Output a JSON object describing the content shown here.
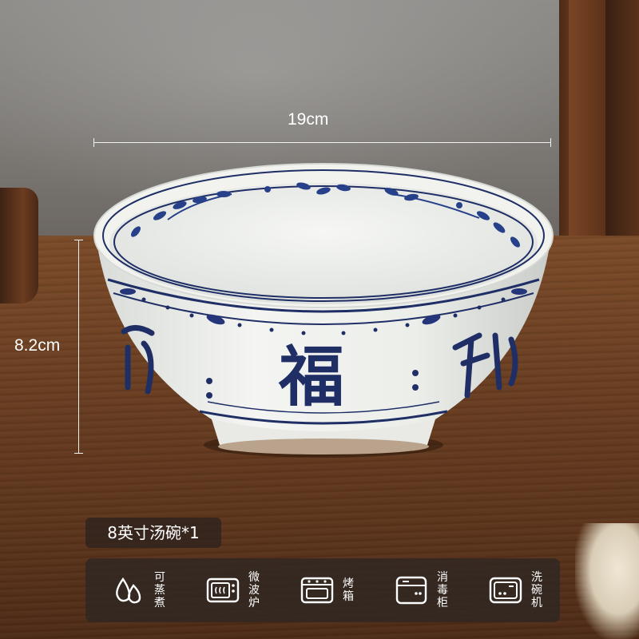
{
  "dimensions": {
    "width": "19cm",
    "height": "8.2cm"
  },
  "bowl": {
    "character": "福"
  },
  "product": {
    "label": "8英寸汤碗*1"
  },
  "features": [
    {
      "icon": "steam-drops-icon",
      "label": "可蒸煮"
    },
    {
      "icon": "microwave-icon",
      "label": "微波炉"
    },
    {
      "icon": "oven-icon",
      "label": "烤箱"
    },
    {
      "icon": "sterilizer-cabinet-icon",
      "label": "消毒柜"
    },
    {
      "icon": "dishwasher-icon",
      "label": "洗碗机"
    }
  ],
  "colors": {
    "porcelain": "#f1f2ee",
    "cobalt": "#1f2f66",
    "panel": "#2d2622"
  }
}
